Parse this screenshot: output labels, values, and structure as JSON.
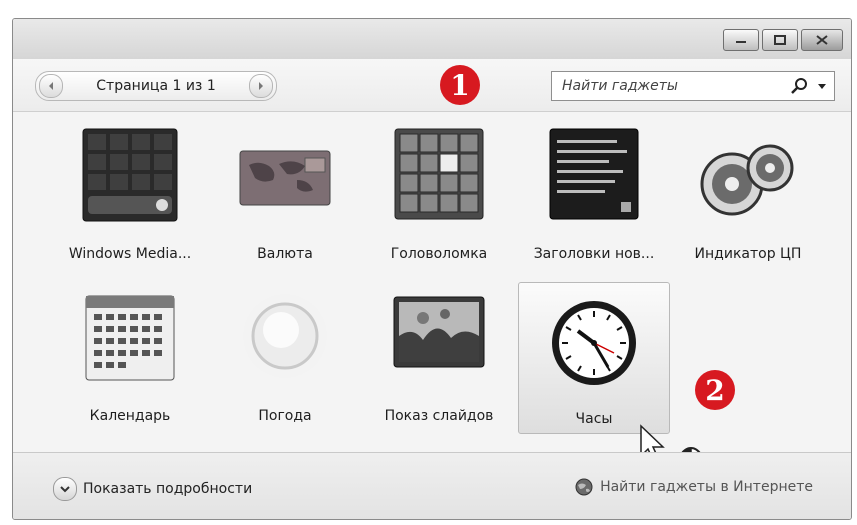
{
  "toolbar": {
    "page_text": "Страница 1 из 1",
    "search_placeholder": "Найти гаджеты"
  },
  "callouts": {
    "one": "1",
    "two": "2"
  },
  "gadgets": [
    {
      "label": "Windows Media...",
      "icon": "windows-media-icon"
    },
    {
      "label": "Валюта",
      "icon": "currency-icon"
    },
    {
      "label": "Головоломка",
      "icon": "puzzle-icon"
    },
    {
      "label": "Заголовки нов...",
      "icon": "news-headlines-icon"
    },
    {
      "label": "Индикатор ЦП",
      "icon": "cpu-meter-icon"
    },
    {
      "label": "Календарь",
      "icon": "calendar-icon"
    },
    {
      "label": "Погода",
      "icon": "weather-icon"
    },
    {
      "label": "Показ слайдов",
      "icon": "slideshow-icon"
    },
    {
      "label": "Часы",
      "icon": "clock-icon",
      "selected": true
    }
  ],
  "footer": {
    "details_label": "Показать подробности",
    "online_label": "Найти гаджеты в Интернете"
  },
  "colors": {
    "callout": "#d71920"
  }
}
